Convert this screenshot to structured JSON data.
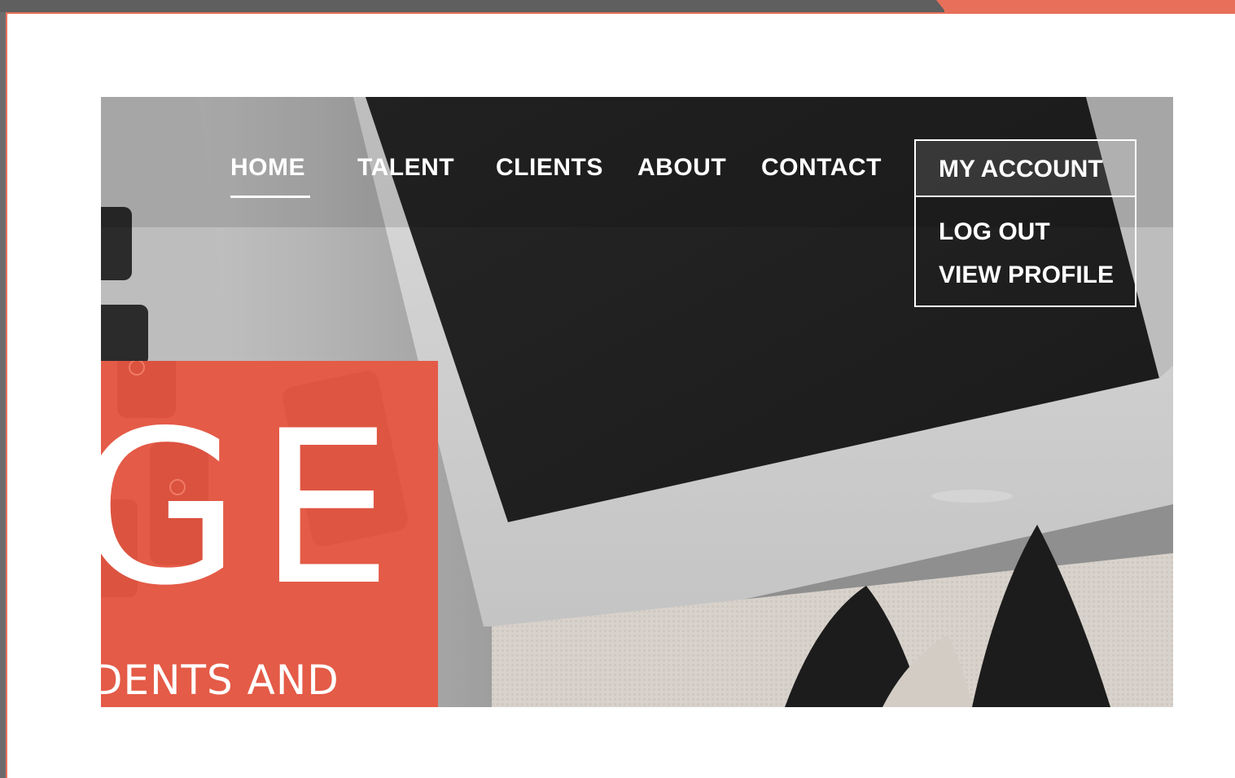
{
  "nav": {
    "items": [
      {
        "label": "HOME",
        "active": true
      },
      {
        "label": "TALENT"
      },
      {
        "label": "CLIENTS"
      },
      {
        "label": "ABOUT"
      },
      {
        "label": "CONTACT"
      }
    ],
    "account": {
      "label": "MY ACCOUNT",
      "menu": [
        "LOG OUT",
        "VIEW PROFILE"
      ]
    }
  },
  "hero": {
    "heading_fragment": "GE",
    "subtitle_fragment": "DENTS AND"
  },
  "colors": {
    "accent": "#e45b47",
    "frame_dark": "#5f5f5f",
    "frame_accent": "#e8705a",
    "nav_text": "#ffffff"
  }
}
